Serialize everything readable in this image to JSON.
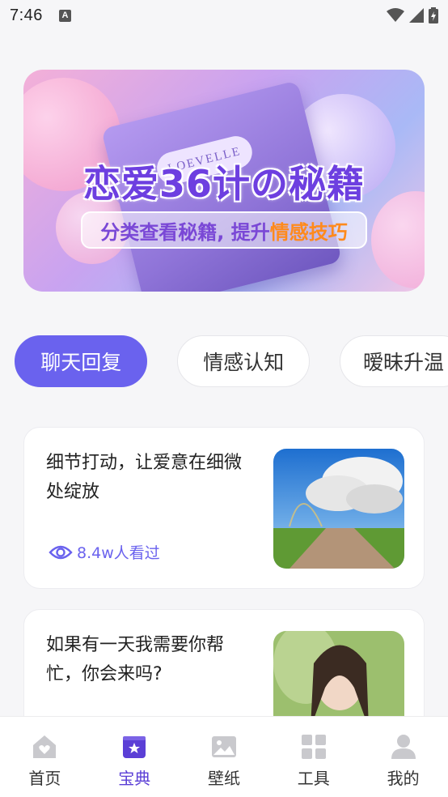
{
  "status_bar": {
    "time": "7:46",
    "notification_letter": "A"
  },
  "banner": {
    "book_label": "LOEVELLE",
    "title": "恋爱36计の秘籍",
    "subtitle_prefix": "分类查看秘籍, 提升",
    "subtitle_highlight": "情感技巧"
  },
  "tabs": [
    {
      "label": "聊天回复",
      "active": true
    },
    {
      "label": "情感认知",
      "active": false
    },
    {
      "label": "暧昧升温",
      "active": false
    }
  ],
  "cards": [
    {
      "title": "细节打动，让爱意在细微处绽放",
      "views": "8.4w人看过"
    },
    {
      "title": "如果有一天我需要你帮忙，你会来吗?",
      "views": ""
    }
  ],
  "bottom_nav": [
    {
      "label": "首页",
      "icon": "home-icon",
      "active": false
    },
    {
      "label": "宝典",
      "icon": "book-star-icon",
      "active": true
    },
    {
      "label": "壁纸",
      "icon": "image-icon",
      "active": false
    },
    {
      "label": "工具",
      "icon": "grid-icon",
      "active": false
    },
    {
      "label": "我的",
      "icon": "user-icon",
      "active": false
    }
  ],
  "colors": {
    "accent": "#6a62ee",
    "active_nav": "#5b3fd6",
    "highlight": "#ff8a1c"
  }
}
